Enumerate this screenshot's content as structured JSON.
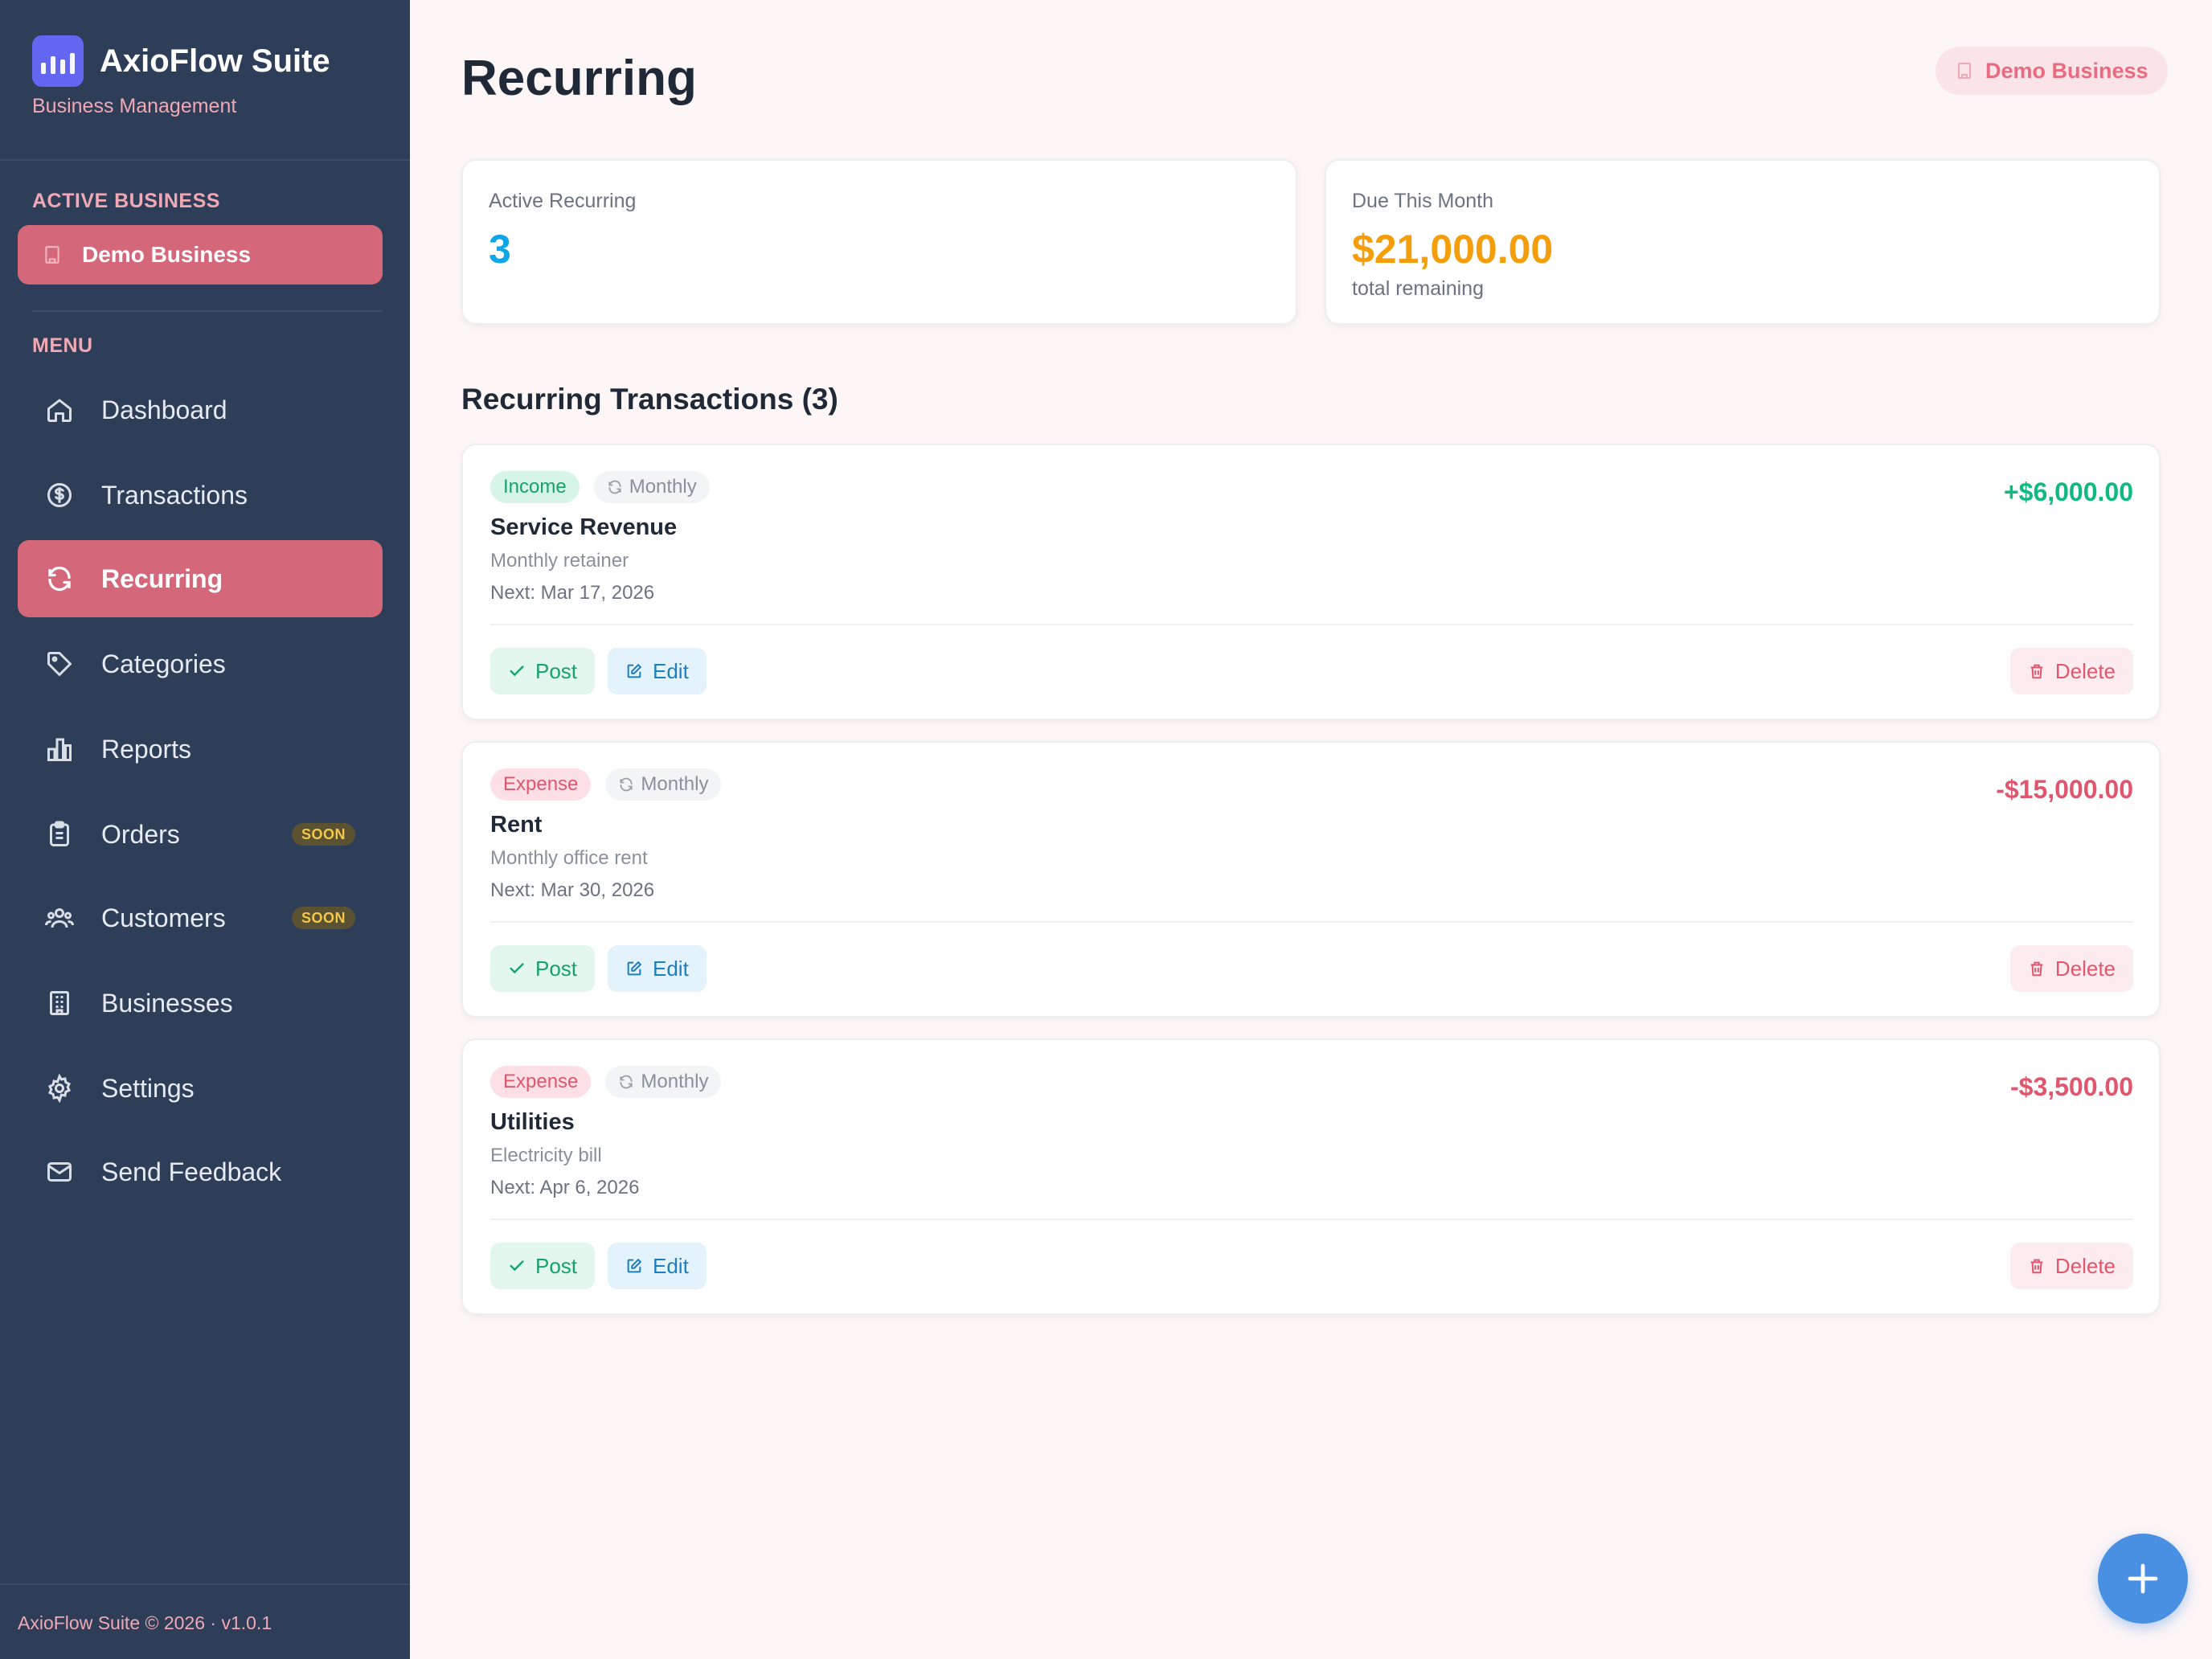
{
  "app": {
    "name": "AxioFlow Suite",
    "subtitle": "Business Management",
    "footer": "AxioFlow Suite © 2026 · v1.0.1"
  },
  "sidebar": {
    "active_business_label": "ACTIVE BUSINESS",
    "active_business": "Demo Business",
    "menu_label": "MENU",
    "items": [
      {
        "label": "Dashboard",
        "icon": "home-icon"
      },
      {
        "label": "Transactions",
        "icon": "dollar-circle-icon"
      },
      {
        "label": "Recurring",
        "icon": "refresh-icon",
        "active": true
      },
      {
        "label": "Categories",
        "icon": "tag-icon"
      },
      {
        "label": "Reports",
        "icon": "bar-chart-icon"
      },
      {
        "label": "Orders",
        "icon": "clipboard-icon",
        "badge": "SOON"
      },
      {
        "label": "Customers",
        "icon": "users-icon",
        "badge": "SOON"
      },
      {
        "label": "Businesses",
        "icon": "building-icon"
      },
      {
        "label": "Settings",
        "icon": "gear-icon"
      },
      {
        "label": "Send Feedback",
        "icon": "mail-icon"
      }
    ]
  },
  "header": {
    "title": "Recurring",
    "business_pill": "Demo Business"
  },
  "stats": [
    {
      "label": "Active Recurring",
      "value": "3",
      "color": "#0ea5e9"
    },
    {
      "label": "Due This Month",
      "value": "$21,000.00",
      "sub": "total remaining",
      "color": "#f59e0b"
    }
  ],
  "list": {
    "title": "Recurring Transactions (3)",
    "items": [
      {
        "type": "Income",
        "frequency": "Monthly",
        "name": "Service Revenue",
        "description": "Monthly retainer",
        "next": "Next: Mar 17, 2026",
        "amount": "+$6,000.00",
        "amount_color": "#10b981"
      },
      {
        "type": "Expense",
        "frequency": "Monthly",
        "name": "Rent",
        "description": "Monthly office rent",
        "next": "Next: Mar 30, 2026",
        "amount": "-$15,000.00",
        "amount_color": "#e0566d"
      },
      {
        "type": "Expense",
        "frequency": "Monthly",
        "name": "Utilities",
        "description": "Electricity bill",
        "next": "Next: Apr 6, 2026",
        "amount": "-$3,500.00",
        "amount_color": "#e0566d"
      }
    ],
    "actions": {
      "post": "Post",
      "edit": "Edit",
      "delete": "Delete"
    }
  },
  "colors": {
    "sidebar_bg": "#2f3e58",
    "accent": "#d5677a",
    "fab": "#4a90e2"
  }
}
